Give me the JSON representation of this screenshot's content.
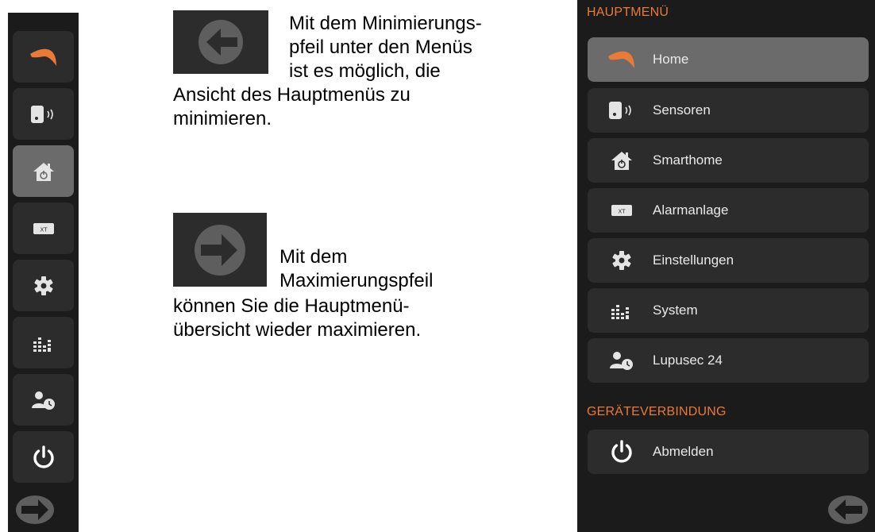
{
  "explain": {
    "minimize_lines": [
      "Mit dem Minimierungs-",
      "pfeil unter den Menüs",
      "ist es möglich, die",
      "Ansicht des Hauptmenüs zu",
      "minimieren."
    ],
    "maximize_lines": [
      "Mit dem",
      "Maximierungspfeil",
      "können Sie die Hauptmenü-",
      "übersicht wieder maximieren."
    ]
  },
  "mini_sidebar": {
    "items": [
      {
        "icon": "home-icon",
        "active": false
      },
      {
        "icon": "sensor-icon",
        "active": false
      },
      {
        "icon": "smarthome-icon",
        "active": true
      },
      {
        "icon": "alarm-panel-icon",
        "active": false
      },
      {
        "icon": "gear-icon",
        "active": false
      },
      {
        "icon": "system-bars-icon",
        "active": false
      },
      {
        "icon": "lupusec-user-icon",
        "active": false
      },
      {
        "icon": "power-icon",
        "active": false
      }
    ],
    "expand_icon": "arrow-right-icon"
  },
  "main_menu": {
    "section_main": "HAUPTMENÜ",
    "items": [
      {
        "label": "Home",
        "icon": "home-icon",
        "active": true
      },
      {
        "label": "Sensoren",
        "icon": "sensor-icon",
        "active": false
      },
      {
        "label": "Smarthome",
        "icon": "smarthome-icon",
        "active": false
      },
      {
        "label": "Alarmanlage",
        "icon": "alarm-panel-icon",
        "active": false
      },
      {
        "label": "Einstellungen",
        "icon": "gear-icon",
        "active": false
      },
      {
        "label": "System",
        "icon": "system-bars-icon",
        "active": false
      },
      {
        "label": "Lupusec 24",
        "icon": "lupusec-user-icon",
        "active": false
      }
    ],
    "section_device": "GERÄTEVERBINDUNG",
    "logout": {
      "label": "Abmelden",
      "icon": "power-icon"
    },
    "collapse_icon": "arrow-left-icon"
  },
  "colors": {
    "panel_bg": "#1b1b1b",
    "button_bg": "#2c2c2c",
    "active_bg": "#6b6b6b",
    "accent_orange": "#ea7a36",
    "icon_light": "#e4e4e4",
    "arrow_grey": "#5e5e5e"
  }
}
